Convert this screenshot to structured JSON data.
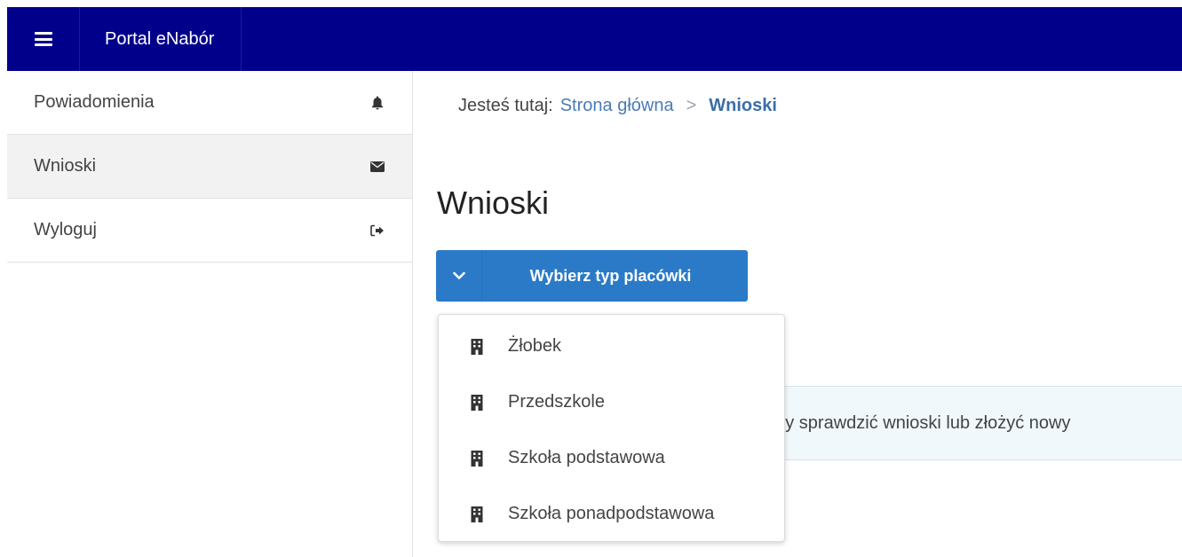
{
  "topbar": {
    "brand": "Portal eNabór",
    "menu_icon": "hamburger-icon",
    "background": "#00008b"
  },
  "sidebar": {
    "items": [
      {
        "label": "Powiadomienia",
        "icon": "bell-icon"
      },
      {
        "label": "Wnioski",
        "icon": "envelope-icon",
        "active": true
      },
      {
        "label": "Wyloguj",
        "icon": "sign-out-icon"
      }
    ]
  },
  "breadcrumb": {
    "prefix": "Jesteś tutaj:",
    "home": "Strona główna",
    "separator": ">",
    "current": "Wnioski"
  },
  "main": {
    "title": "Wnioski",
    "type_button": "Wybierz typ placówki",
    "info_text": "aby sprawdzić wnioski lub złożyć nowy",
    "accent": "#2a7ac7"
  },
  "dropdown": {
    "items": [
      {
        "label": "Żłobek",
        "icon": "building-icon"
      },
      {
        "label": "Przedszkole",
        "icon": "building-icon"
      },
      {
        "label": "Szkoła podstawowa",
        "icon": "building-icon"
      },
      {
        "label": "Szkoła ponadpodstawowa",
        "icon": "building-icon"
      }
    ]
  }
}
